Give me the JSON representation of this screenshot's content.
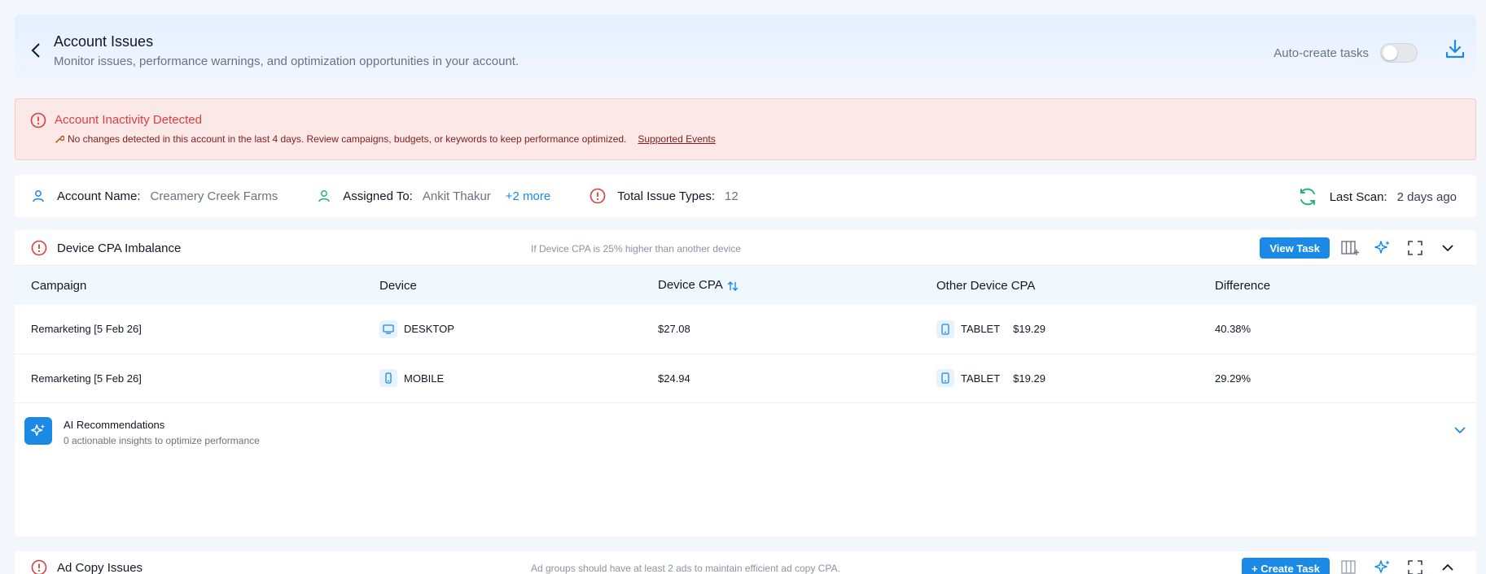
{
  "header": {
    "title": "Account Issues",
    "subtitle": "Monitor issues, performance warnings, and optimization opportunities in your account.",
    "auto_create_label": "Auto-create tasks"
  },
  "alert": {
    "title": "Account Inactivity Detected",
    "message": "No changes detected in this account in the last 4 days. Review campaigns, budgets, or keywords to keep performance optimized.",
    "link": "Supported Events"
  },
  "info": {
    "account_label": "Account Name:",
    "account_value": "Creamery Creek Farms",
    "assigned_label": "Assigned To:",
    "assigned_value": "Ankit Thakur",
    "assigned_more": "+2 more",
    "issues_label": "Total Issue Types:",
    "issues_value": "12",
    "scan_label": "Last Scan:",
    "scan_value": "2 days ago"
  },
  "device_card": {
    "title": "Device CPA Imbalance",
    "condition": "If Device CPA is 25% higher than another device",
    "view_task": "View Task",
    "columns": [
      "Campaign",
      "Device",
      "Device CPA",
      "Other Device CPA",
      "Difference"
    ],
    "rows": [
      {
        "campaign": "Remarketing [5 Feb 26]",
        "device": "DESKTOP",
        "device_icon": "desktop-icon",
        "cpa": "$27.08",
        "other_device": "TABLET",
        "other_icon": "tablet-icon",
        "other_cpa": "$19.29",
        "difference": "40.38%"
      },
      {
        "campaign": "Remarketing [5 Feb 26]",
        "device": "MOBILE",
        "device_icon": "mobile-icon",
        "cpa": "$24.94",
        "other_device": "TABLET",
        "other_icon": "tablet-icon",
        "other_cpa": "$19.29",
        "difference": "29.29%"
      }
    ],
    "ai_title": "AI Recommendations",
    "ai_sub": "0 actionable insights to optimize performance"
  },
  "adcopy_card": {
    "title": "Ad Copy Issues",
    "condition": "Ad groups should have at least 2 ads to maintain efficient ad copy CPA.",
    "create_task": "+ Create Task"
  },
  "colors": {
    "accent": "#1a8ae6",
    "danger": "#dc3e3e",
    "success": "#22b573"
  }
}
